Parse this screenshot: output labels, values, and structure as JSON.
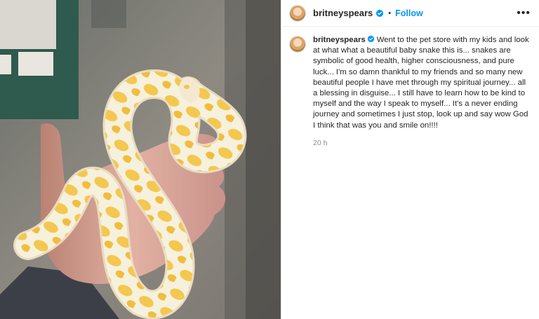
{
  "post": {
    "username": "britneyspears",
    "separator": "•",
    "follow_label": "Follow",
    "more_label": "•••",
    "caption": "Went to the pet store with my kids and look at what what a beautiful baby snake this is... snakes are symbolic of good health, higher consciousness, and pure luck... I'm so damn thankful to my friends and so many new beautiful people I have met through my spiritual journey... all a blessing in disguise... I still have to learn how to be kind to myself and the way I speak to myself... It's a never ending journey and sometimes I just stop, look up and say wow God I think that was you and smile on!!!!",
    "timestamp": "20 h",
    "icons": {
      "verified": "verified-badge-icon",
      "more": "more-options-icon"
    },
    "colors": {
      "accent": "#0095f6",
      "text": "#262626",
      "muted": "#8e8e8e",
      "divider": "#efefef",
      "snake_base": "#f6f0d8",
      "snake_pattern": "#f5c84c"
    }
  }
}
